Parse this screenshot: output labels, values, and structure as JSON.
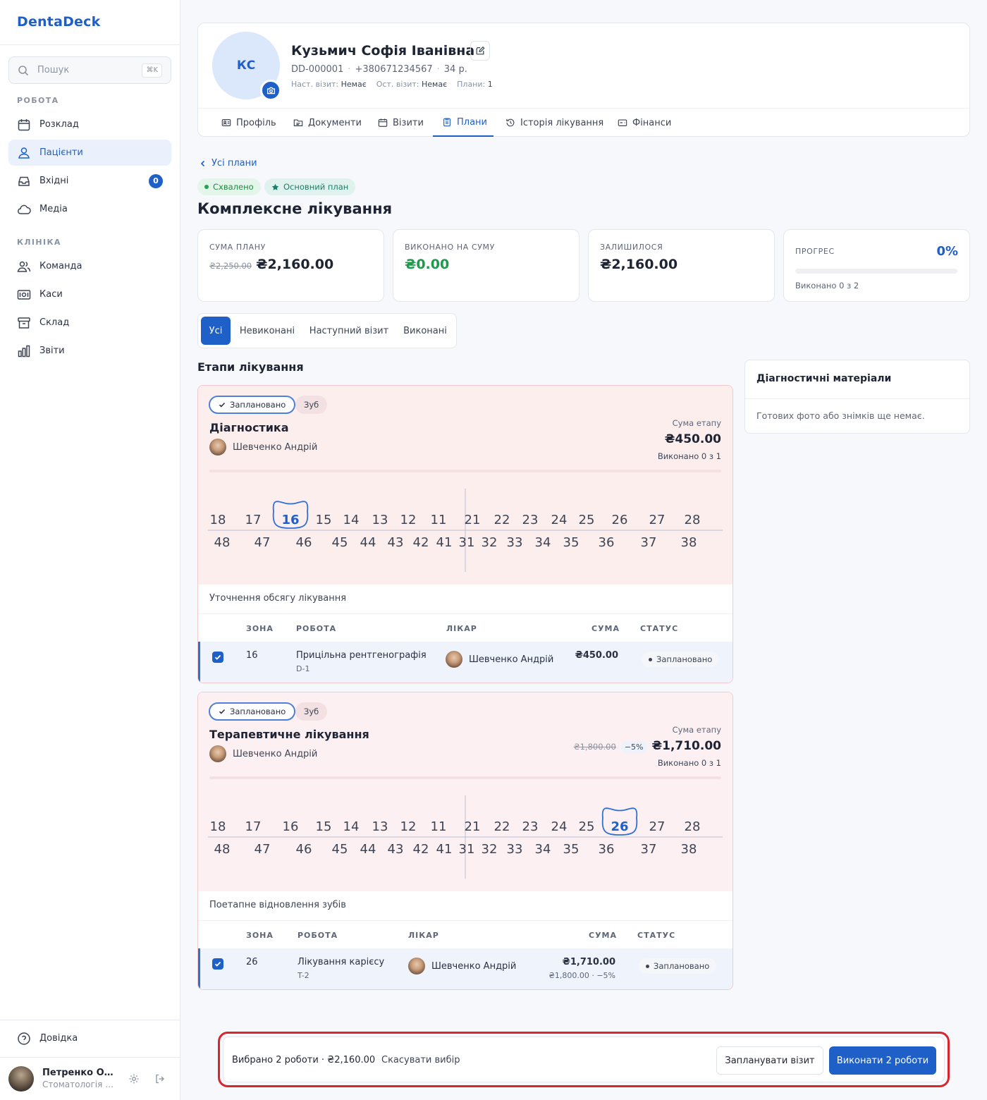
{
  "app": {
    "name": "DentaDeck"
  },
  "sidebar": {
    "search_placeholder": "Пошук",
    "search_shortcut": "⌘K",
    "section_work": "РОБОТА",
    "section_clinic": "КЛІНІКА",
    "items": [
      {
        "label": "Розклад",
        "icon": "calendar-icon"
      },
      {
        "label": "Пацієнти",
        "icon": "users-icon",
        "active": true
      },
      {
        "label": "Вхідні",
        "icon": "inbox-icon",
        "badge": "0"
      },
      {
        "label": "Медіа",
        "icon": "cloud-icon"
      },
      {
        "label": "Команда",
        "icon": "team-icon"
      },
      {
        "label": "Каси",
        "icon": "cash-register-icon"
      },
      {
        "label": "Склад",
        "icon": "archive-icon"
      },
      {
        "label": "Звіти",
        "icon": "bar-chart-icon"
      }
    ],
    "help": "Довідка",
    "user": {
      "name": "Петренко Олександр",
      "role": "Стоматологія Плюс"
    }
  },
  "patient": {
    "initials": "КС",
    "name": "Кузьмич Софія Іванівна",
    "id": "DD-000001",
    "phone": "+380671234567",
    "age": "34 р.",
    "next_visit_label": "Наст. візит:",
    "next_visit": "Немає",
    "last_visit_label": "Ост. візит:",
    "last_visit": "Немає",
    "plans_label": "Плани:",
    "plans": "1"
  },
  "tabs": [
    {
      "label": "Профіль",
      "icon": "profile-card-icon"
    },
    {
      "label": "Документи",
      "icon": "folder-icon"
    },
    {
      "label": "Візити",
      "icon": "calendar-icon"
    },
    {
      "label": "Плани",
      "icon": "clipboard-icon",
      "active": true
    },
    {
      "label": "Історія лікування",
      "icon": "history-icon"
    },
    {
      "label": "Фінанси",
      "icon": "wallet-icon"
    }
  ],
  "plan": {
    "back": "Усі плани",
    "status_badge": "Схвалено",
    "main_badge": "Основний план",
    "title": "Комплексне лікування",
    "stats": {
      "sum_label": "СУМА ПЛАНУ",
      "sum_old": "₴2,250.00",
      "sum": "₴2,160.00",
      "done_label": "ВИКОНАНО НА СУМУ",
      "done": "₴0.00",
      "left_label": "ЗАЛИШИЛОСЯ",
      "left": "₴2,160.00",
      "progress_label": "ПРОГРЕС",
      "progress_pct": "0%",
      "progress_value": 0,
      "progress_sub": "Виконано 0 з 2"
    },
    "filters": [
      "Усі",
      "Невиконані",
      "Наступний візит",
      "Виконані"
    ],
    "stages_title": "Етапи лікування"
  },
  "teeth": {
    "upper": [
      "18",
      "17",
      "16",
      "15",
      "14",
      "13",
      "12",
      "11",
      "21",
      "22",
      "23",
      "24",
      "25",
      "26",
      "27",
      "28"
    ],
    "lower": [
      "48",
      "47",
      "46",
      "45",
      "44",
      "43",
      "42",
      "41",
      "31",
      "32",
      "33",
      "34",
      "35",
      "36",
      "37",
      "38"
    ]
  },
  "table_headers": {
    "zone": "ЗОНА",
    "work": "РОБОТА",
    "doctor": "ЛІКАР",
    "sum": "СУМА",
    "status": "СТАТУС"
  },
  "stages": [
    {
      "status": "Заплановано",
      "type": "Зуб",
      "name": "Діагностика",
      "doctor": "Шевченко Андрій",
      "sum_label": "Сума етапу",
      "sum": "₴450.00",
      "done": "Виконано 0 з 1",
      "highlight_tooth": "16",
      "note": "Уточнення обсягу лікування",
      "row": {
        "zone": "16",
        "work": "Прицільна рентгенографія",
        "code": "D-1",
        "doctor": "Шевченко Андрій",
        "sum": "₴450.00",
        "status": "Заплановано"
      }
    },
    {
      "status": "Заплановано",
      "type": "Зуб",
      "name": "Терапевтичне лікування",
      "doctor": "Шевченко Андрій",
      "sum_label": "Сума етапу",
      "sum_old": "₴1,800.00",
      "discount": "−5%",
      "sum": "₴1,710.00",
      "done": "Виконано 0 з 1",
      "highlight_tooth": "26",
      "note": "Поетапне відновлення зубів",
      "row": {
        "zone": "26",
        "work": "Лікування карієсу",
        "code": "T-2",
        "doctor": "Шевченко Андрій",
        "sum": "₴1,710.00",
        "sum_detail": "₴1,800.00 · −5%",
        "status": "Заплановано"
      }
    }
  ],
  "diagnostics": {
    "title": "Діагностичні матеріали",
    "empty": "Готових фото або знімків ще немає."
  },
  "bottom_bar": {
    "selected": "Вибрано 2 роботи · ₴2,160.00",
    "cancel": "Скасувати вибір",
    "schedule": "Запланувати візит",
    "execute": "Виконати 2 роботи"
  },
  "colors": {
    "accent": "#1f5fc8",
    "success": "#1f9a4c",
    "stage_bg": "#fdeeee",
    "highlight": "#d8262c"
  }
}
